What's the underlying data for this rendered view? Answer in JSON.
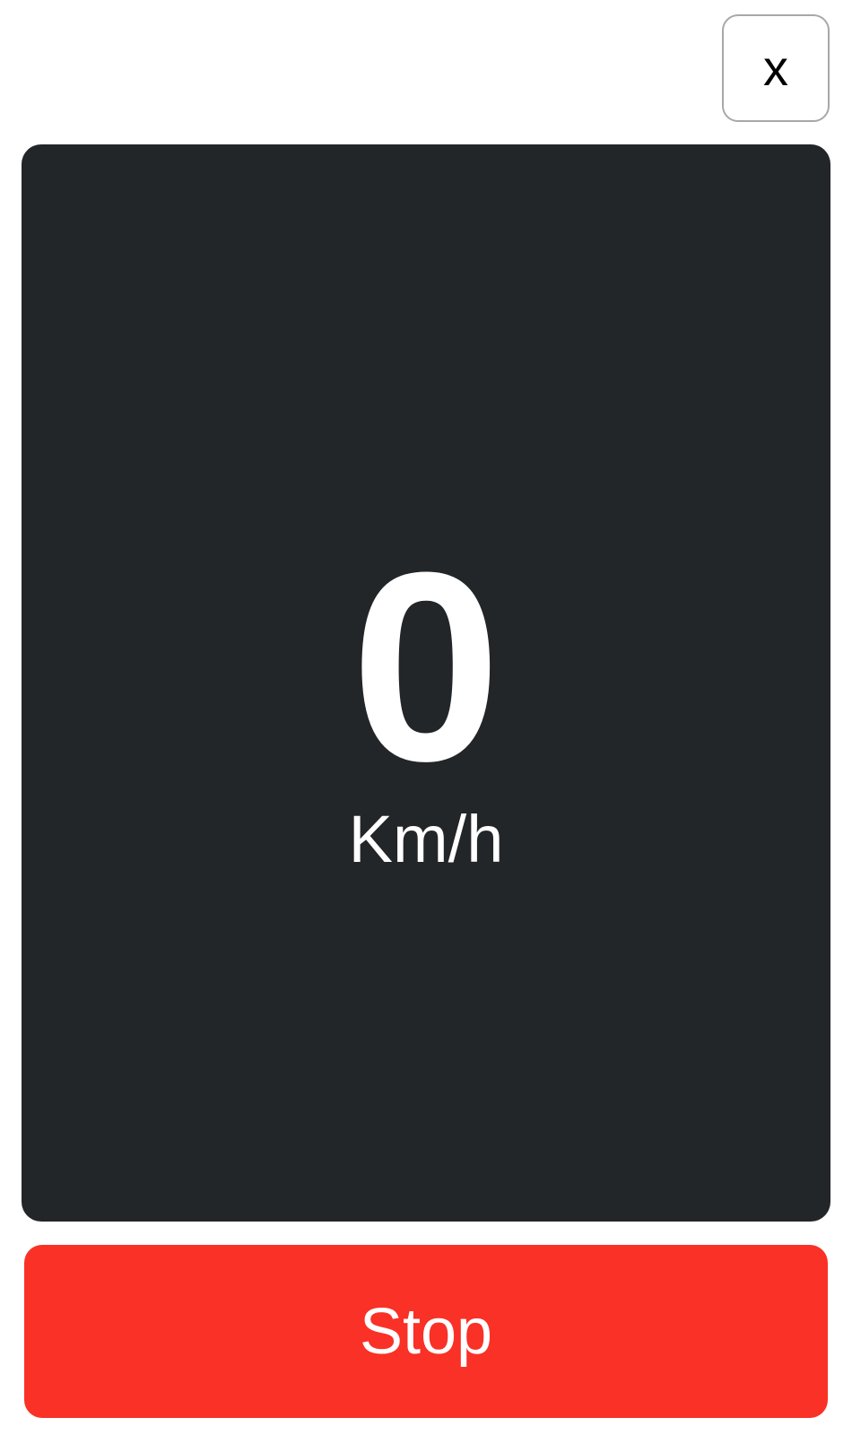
{
  "header": {
    "close_label": "x"
  },
  "speedometer": {
    "value": "0",
    "unit": "Km/h"
  },
  "actions": {
    "stop_label": "Stop"
  },
  "colors": {
    "panel_background": "#222628",
    "stop_button": "#f93126",
    "text_on_dark": "#ffffff"
  }
}
